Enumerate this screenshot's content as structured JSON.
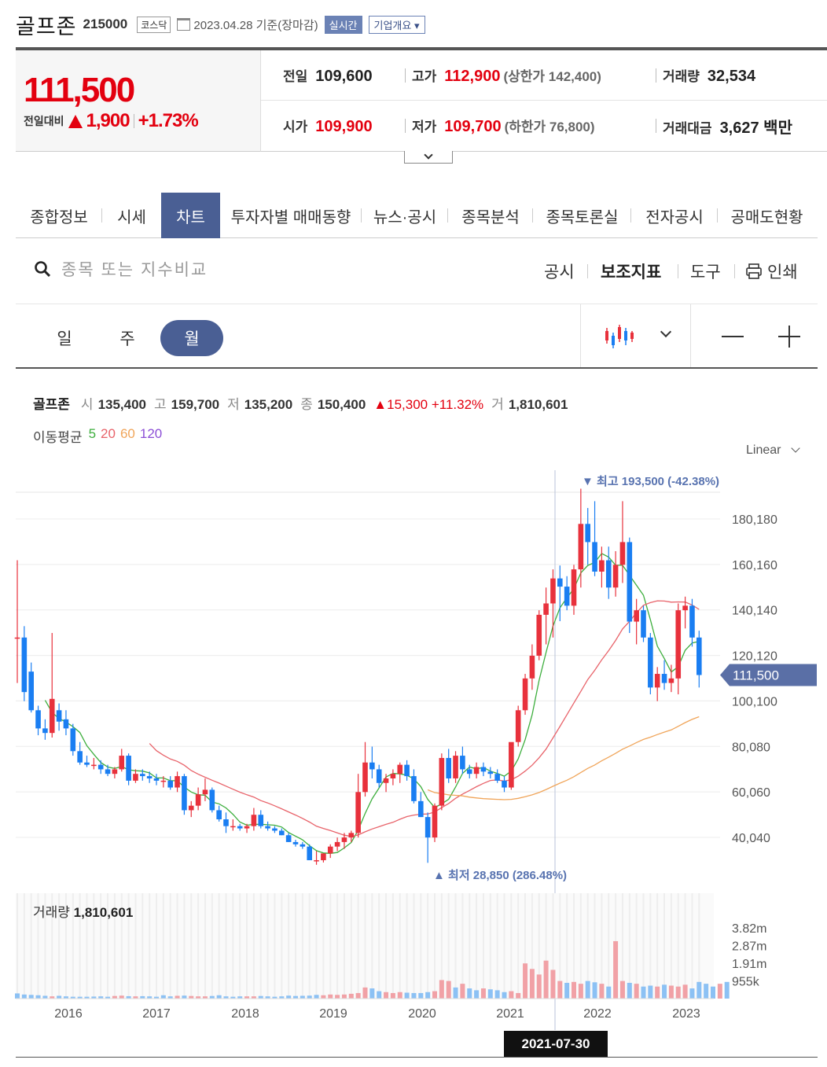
{
  "header": {
    "name": "골프존",
    "code": "215000",
    "market": "코스닥",
    "date": "2023.04.28 기준(장마감)",
    "realtime": "실시간",
    "company_info": "기업개요 ▾"
  },
  "price": {
    "current": "111,500",
    "change_label": "전일대비",
    "change": "1,900",
    "change_pct": "+1.73%"
  },
  "stats": {
    "prev_close_label": "전일",
    "prev_close": "109,600",
    "high_label": "고가",
    "high": "112,900",
    "upper_limit": "(상한가 142,400)",
    "volume_label": "거래량",
    "volume": "32,534",
    "open_label": "시가",
    "open": "109,900",
    "low_label": "저가",
    "low": "109,700",
    "lower_limit": "(하한가 76,800)",
    "amount_label": "거래대금",
    "amount": "3,627 백만"
  },
  "tabs": [
    "종합정보",
    "시세",
    "차트",
    "투자자별 매매동향",
    "뉴스·공시",
    "종목분석",
    "종목토론실",
    "전자공시",
    "공매도현황"
  ],
  "active_tab": 2,
  "toolbar": {
    "search_placeholder": "종목 또는 지수비교",
    "disclosure": "공시",
    "indicators": "보조지표",
    "tools": "도구",
    "print": "인쇄"
  },
  "periods": [
    "일",
    "주",
    "월"
  ],
  "active_period": 2,
  "chart_info": {
    "name": "골프존",
    "open_label": "시",
    "open": "135,400",
    "high_label": "고",
    "high": "159,700",
    "low_label": "저",
    "low": "135,200",
    "close_label": "종",
    "close": "150,400",
    "change": "▲15,300 +11.32%",
    "vol_label": "거",
    "vol": "1,810,601",
    "ma_label": "이동평균",
    "ma5": "5",
    "ma20": "20",
    "ma60": "60",
    "ma120": "120",
    "scale": "Linear"
  },
  "colors": {
    "up": "#e8313c",
    "down": "#1a7ef2",
    "ma5": "#3dae3d",
    "ma20": "#e8636a",
    "ma60": "#f0a55a",
    "ma120": "#8c4fd6",
    "accent": "#4a5f94"
  },
  "volume_label": "거래량",
  "volume_value": "1,810,601",
  "crosshair_date": "2021-07-30",
  "chart_data": {
    "type": "candlestick",
    "y_ticks": [
      "180,180",
      "160,160",
      "140,140",
      "120,120",
      "100,100",
      "80,080",
      "60,060",
      "40,040"
    ],
    "y_tick_values": [
      180180,
      160160,
      140140,
      120120,
      100100,
      80080,
      60060,
      40040
    ],
    "x_ticks": [
      "2016",
      "2017",
      "2018",
      "2019",
      "2020",
      "2021",
      "2022",
      "2023"
    ],
    "current_price": 111500,
    "current_price_label": "111,500",
    "max_label": "▼ 최고 193,500 (-42.38%)",
    "min_label": "▲ 최저 28,850 (286.48%)",
    "vol_ticks": [
      "3.82m",
      "2.87m",
      "1.91m",
      "955k"
    ],
    "vol_tick_values": [
      3820000,
      2870000,
      1910000,
      955000
    ],
    "candles": [
      {
        "o": 128000,
        "h": 162000,
        "l": 108000,
        "c": 128000
      },
      {
        "o": 128000,
        "h": 133000,
        "l": 100000,
        "c": 104000
      },
      {
        "o": 113000,
        "h": 117000,
        "l": 95000,
        "c": 96000
      },
      {
        "o": 96000,
        "h": 98000,
        "l": 85000,
        "c": 88000
      },
      {
        "o": 88000,
        "h": 92000,
        "l": 83000,
        "c": 86000
      },
      {
        "o": 86000,
        "h": 130000,
        "l": 84000,
        "c": 101000
      },
      {
        "o": 96000,
        "h": 99000,
        "l": 87000,
        "c": 91000
      },
      {
        "o": 92000,
        "h": 96000,
        "l": 85000,
        "c": 88000
      },
      {
        "o": 88000,
        "h": 90000,
        "l": 76000,
        "c": 78000
      },
      {
        "o": 78000,
        "h": 82000,
        "l": 72000,
        "c": 73000
      },
      {
        "o": 73000,
        "h": 76000,
        "l": 71000,
        "c": 72000
      },
      {
        "o": 72000,
        "h": 75000,
        "l": 70000,
        "c": 72000
      },
      {
        "o": 72000,
        "h": 74000,
        "l": 68000,
        "c": 70000
      },
      {
        "o": 70000,
        "h": 72000,
        "l": 67000,
        "c": 68000
      },
      {
        "o": 68000,
        "h": 71000,
        "l": 66000,
        "c": 70000
      },
      {
        "o": 70000,
        "h": 79000,
        "l": 69000,
        "c": 76000
      },
      {
        "o": 76000,
        "h": 77000,
        "l": 63000,
        "c": 65000
      },
      {
        "o": 65000,
        "h": 70000,
        "l": 64000,
        "c": 68000
      },
      {
        "o": 68000,
        "h": 70000,
        "l": 65000,
        "c": 67000
      },
      {
        "o": 67000,
        "h": 69000,
        "l": 64000,
        "c": 66000
      },
      {
        "o": 66000,
        "h": 68000,
        "l": 63000,
        "c": 65000
      },
      {
        "o": 65000,
        "h": 67000,
        "l": 62000,
        "c": 65000
      },
      {
        "o": 65000,
        "h": 67000,
        "l": 61000,
        "c": 62000
      },
      {
        "o": 62000,
        "h": 69000,
        "l": 60000,
        "c": 67000
      },
      {
        "o": 67000,
        "h": 68000,
        "l": 50000,
        "c": 52000
      },
      {
        "o": 52000,
        "h": 56000,
        "l": 49000,
        "c": 54000
      },
      {
        "o": 54000,
        "h": 62000,
        "l": 52000,
        "c": 59000
      },
      {
        "o": 59000,
        "h": 66000,
        "l": 56000,
        "c": 61000
      },
      {
        "o": 61000,
        "h": 62000,
        "l": 51000,
        "c": 52000
      },
      {
        "o": 52000,
        "h": 54000,
        "l": 47000,
        "c": 48000
      },
      {
        "o": 48000,
        "h": 51000,
        "l": 42000,
        "c": 45000
      },
      {
        "o": 45000,
        "h": 48000,
        "l": 43000,
        "c": 45000
      },
      {
        "o": 45000,
        "h": 46000,
        "l": 43000,
        "c": 44000
      },
      {
        "o": 44000,
        "h": 46000,
        "l": 42000,
        "c": 45000
      },
      {
        "o": 45000,
        "h": 53000,
        "l": 43000,
        "c": 50000
      },
      {
        "o": 50000,
        "h": 52000,
        "l": 44000,
        "c": 45000
      },
      {
        "o": 45000,
        "h": 47000,
        "l": 43000,
        "c": 44000
      },
      {
        "o": 44000,
        "h": 45000,
        "l": 42000,
        "c": 43000
      },
      {
        "o": 43000,
        "h": 44000,
        "l": 41000,
        "c": 41000
      },
      {
        "o": 41000,
        "h": 42000,
        "l": 38000,
        "c": 38000
      },
      {
        "o": 38000,
        "h": 39000,
        "l": 36000,
        "c": 37000
      },
      {
        "o": 37000,
        "h": 38000,
        "l": 35000,
        "c": 36000
      },
      {
        "o": 36000,
        "h": 37000,
        "l": 33000,
        "c": 30000
      },
      {
        "o": 30000,
        "h": 34000,
        "l": 28000,
        "c": 30000
      },
      {
        "o": 30000,
        "h": 33000,
        "l": 29000,
        "c": 33000
      },
      {
        "o": 33000,
        "h": 37000,
        "l": 31000,
        "c": 36000
      },
      {
        "o": 36000,
        "h": 40000,
        "l": 34000,
        "c": 38000
      },
      {
        "o": 38000,
        "h": 42000,
        "l": 35000,
        "c": 40000
      },
      {
        "o": 40000,
        "h": 43000,
        "l": 38000,
        "c": 42000
      },
      {
        "o": 42000,
        "h": 68000,
        "l": 40000,
        "c": 60000
      },
      {
        "o": 60000,
        "h": 82000,
        "l": 58000,
        "c": 73000
      },
      {
        "o": 73000,
        "h": 80000,
        "l": 66000,
        "c": 70000
      },
      {
        "o": 70000,
        "h": 72000,
        "l": 62000,
        "c": 64000
      },
      {
        "o": 64000,
        "h": 68000,
        "l": 60000,
        "c": 66000
      },
      {
        "o": 66000,
        "h": 70000,
        "l": 63000,
        "c": 68000
      },
      {
        "o": 68000,
        "h": 73000,
        "l": 64000,
        "c": 72000
      },
      {
        "o": 72000,
        "h": 74000,
        "l": 65000,
        "c": 67000
      },
      {
        "o": 67000,
        "h": 70000,
        "l": 55000,
        "c": 56000
      },
      {
        "o": 56000,
        "h": 60000,
        "l": 49000,
        "c": 49000
      },
      {
        "o": 49000,
        "h": 51000,
        "l": 28850,
        "c": 40000
      },
      {
        "o": 40000,
        "h": 55000,
        "l": 38000,
        "c": 54000
      },
      {
        "o": 54000,
        "h": 77000,
        "l": 52000,
        "c": 75000
      },
      {
        "o": 75000,
        "h": 79000,
        "l": 64000,
        "c": 66000
      },
      {
        "o": 66000,
        "h": 78000,
        "l": 64000,
        "c": 76000
      },
      {
        "o": 76000,
        "h": 80000,
        "l": 68000,
        "c": 70000
      },
      {
        "o": 70000,
        "h": 72000,
        "l": 66000,
        "c": 68000
      },
      {
        "o": 68000,
        "h": 73000,
        "l": 66000,
        "c": 71000
      },
      {
        "o": 71000,
        "h": 73000,
        "l": 67000,
        "c": 69000
      },
      {
        "o": 69000,
        "h": 71000,
        "l": 66000,
        "c": 68000
      },
      {
        "o": 68000,
        "h": 70000,
        "l": 64000,
        "c": 65000
      },
      {
        "o": 65000,
        "h": 67000,
        "l": 60000,
        "c": 62000
      },
      {
        "o": 62000,
        "h": 80000,
        "l": 61000,
        "c": 82000
      },
      {
        "o": 82000,
        "h": 98000,
        "l": 80000,
        "c": 96000
      },
      {
        "o": 96000,
        "h": 112000,
        "l": 94000,
        "c": 110000
      },
      {
        "o": 110000,
        "h": 125000,
        "l": 105000,
        "c": 120000
      },
      {
        "o": 120000,
        "h": 140000,
        "l": 118000,
        "c": 138000
      },
      {
        "o": 138000,
        "h": 150000,
        "l": 125000,
        "c": 143000
      },
      {
        "o": 143000,
        "h": 158000,
        "l": 128000,
        "c": 154000
      },
      {
        "o": 154000,
        "h": 159700,
        "l": 135200,
        "c": 150400
      },
      {
        "o": 150400,
        "h": 155000,
        "l": 140000,
        "c": 142000
      },
      {
        "o": 142000,
        "h": 160000,
        "l": 138000,
        "c": 158000
      },
      {
        "o": 158000,
        "h": 193500,
        "l": 150000,
        "c": 178000
      },
      {
        "o": 178000,
        "h": 185000,
        "l": 160000,
        "c": 170000
      },
      {
        "o": 170000,
        "h": 188000,
        "l": 155000,
        "c": 157000
      },
      {
        "o": 157000,
        "h": 168000,
        "l": 150000,
        "c": 162000
      },
      {
        "o": 162000,
        "h": 168000,
        "l": 145000,
        "c": 150000
      },
      {
        "o": 150000,
        "h": 166000,
        "l": 146000,
        "c": 160000
      },
      {
        "o": 160000,
        "h": 188000,
        "l": 152000,
        "c": 170000
      },
      {
        "o": 170000,
        "h": 172000,
        "l": 130000,
        "c": 135000
      },
      {
        "o": 135000,
        "h": 145000,
        "l": 125000,
        "c": 140000
      },
      {
        "o": 140000,
        "h": 142000,
        "l": 126000,
        "c": 128000
      },
      {
        "o": 128000,
        "h": 130000,
        "l": 103000,
        "c": 106000
      },
      {
        "o": 106000,
        "h": 115000,
        "l": 100000,
        "c": 112000
      },
      {
        "o": 112000,
        "h": 118000,
        "l": 105000,
        "c": 108000
      },
      {
        "o": 108000,
        "h": 116000,
        "l": 104000,
        "c": 110000
      },
      {
        "o": 110000,
        "h": 143000,
        "l": 103000,
        "c": 140000
      },
      {
        "o": 140000,
        "h": 146000,
        "l": 132000,
        "c": 142000
      },
      {
        "o": 142000,
        "h": 145000,
        "l": 124000,
        "c": 128000
      },
      {
        "o": 128000,
        "h": 131000,
        "l": 106000,
        "c": 111500
      }
    ],
    "volumes": [
      0.28,
      0.22,
      0.2,
      0.18,
      0.15,
      0.12,
      0.15,
      0.12,
      0.1,
      0.1,
      0.1,
      0.11,
      0.12,
      0.1,
      0.14,
      0.16,
      0.13,
      0.12,
      0.13,
      0.12,
      0.1,
      0.18,
      0.12,
      0.15,
      0.16,
      0.14,
      0.12,
      0.12,
      0.14,
      0.18,
      0.12,
      0.1,
      0.12,
      0.12,
      0.12,
      0.14,
      0.12,
      0.1,
      0.12,
      0.16,
      0.14,
      0.15,
      0.16,
      0.2,
      0.18,
      0.22,
      0.2,
      0.22,
      0.26,
      0.3,
      0.6,
      0.55,
      0.4,
      0.35,
      0.3,
      0.35,
      0.32,
      0.3,
      0.3,
      0.35,
      0.4,
      1.0,
      0.95,
      0.6,
      0.8,
      0.55,
      0.45,
      0.55,
      0.5,
      0.45,
      0.35,
      0.4,
      0.3,
      1.9,
      1.6,
      1.3,
      2.05,
      1.55,
      0.95,
      0.85,
      0.9,
      0.8,
      0.95,
      0.88,
      0.8,
      0.65,
      3.1,
      0.95,
      0.85,
      0.8,
      0.65,
      0.7,
      0.65,
      0.75,
      0.7,
      0.65,
      0.75,
      0.55,
      0.9,
      0.8,
      0.65,
      0.8,
      0.9
    ],
    "vol_up": [
      false,
      false,
      false,
      false,
      false,
      true,
      false,
      false,
      false,
      false,
      false,
      false,
      false,
      false,
      true,
      true,
      false,
      true,
      false,
      false,
      false,
      false,
      false,
      true,
      false,
      true,
      true,
      true,
      false,
      false,
      false,
      false,
      false,
      true,
      true,
      false,
      false,
      false,
      false,
      false,
      false,
      false,
      false,
      false,
      true,
      true,
      true,
      true,
      true,
      true,
      true,
      false,
      false,
      true,
      true,
      true,
      false,
      false,
      false,
      false,
      true,
      true,
      true,
      false,
      true,
      false,
      false,
      true,
      false,
      false,
      false,
      true,
      true,
      true,
      true,
      true,
      true,
      true,
      true,
      false,
      true,
      true,
      false,
      false,
      true,
      false,
      true,
      true,
      false,
      true,
      false,
      false,
      true,
      false,
      true,
      true,
      true,
      false,
      false,
      false,
      false,
      true,
      false
    ],
    "ma5": [],
    "ma20": [],
    "ma60": []
  }
}
